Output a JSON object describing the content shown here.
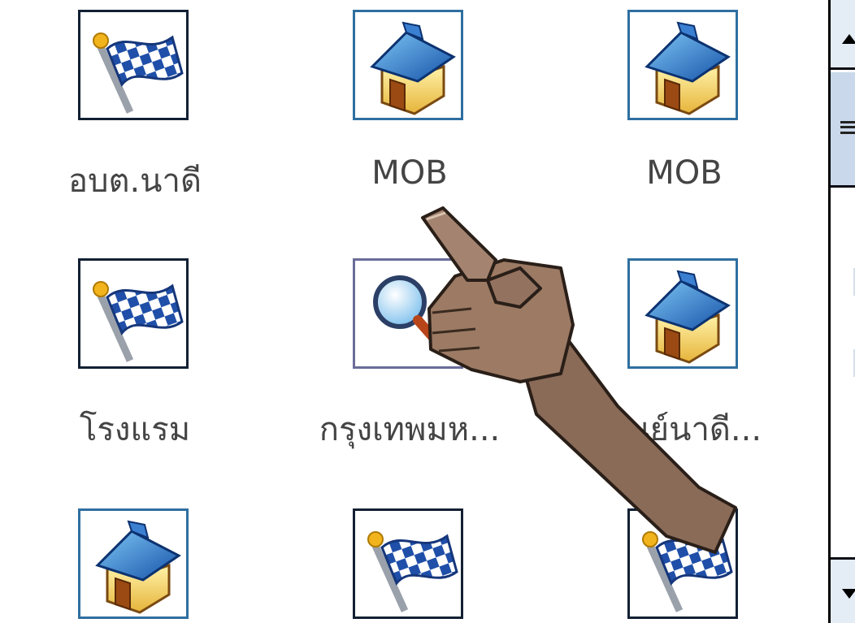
{
  "window": {
    "title": ""
  },
  "items": [
    {
      "label": "อบต.นาดี",
      "icon": "checkered-flag-icon"
    },
    {
      "label": "MOB",
      "icon": "house-icon"
    },
    {
      "label": "MOB",
      "icon": "house-icon"
    },
    {
      "label": "โรงแรม",
      "icon": "checkered-flag-icon"
    },
    {
      "label": "กรุงเทพมห...",
      "icon": "magnifier-icon"
    },
    {
      "label": "ศูนย์นาดี...",
      "icon": "house-icon"
    },
    {
      "label": "",
      "icon": "house-icon"
    },
    {
      "label": "",
      "icon": "checkered-flag-icon"
    },
    {
      "label": "",
      "icon": "checkered-flag-icon"
    }
  ],
  "cursor": {
    "icon": "pointing-hand-cursor"
  },
  "scrollbar": {
    "up_icon": "arrow-up-icon",
    "down_icon": "arrow-down-icon"
  }
}
